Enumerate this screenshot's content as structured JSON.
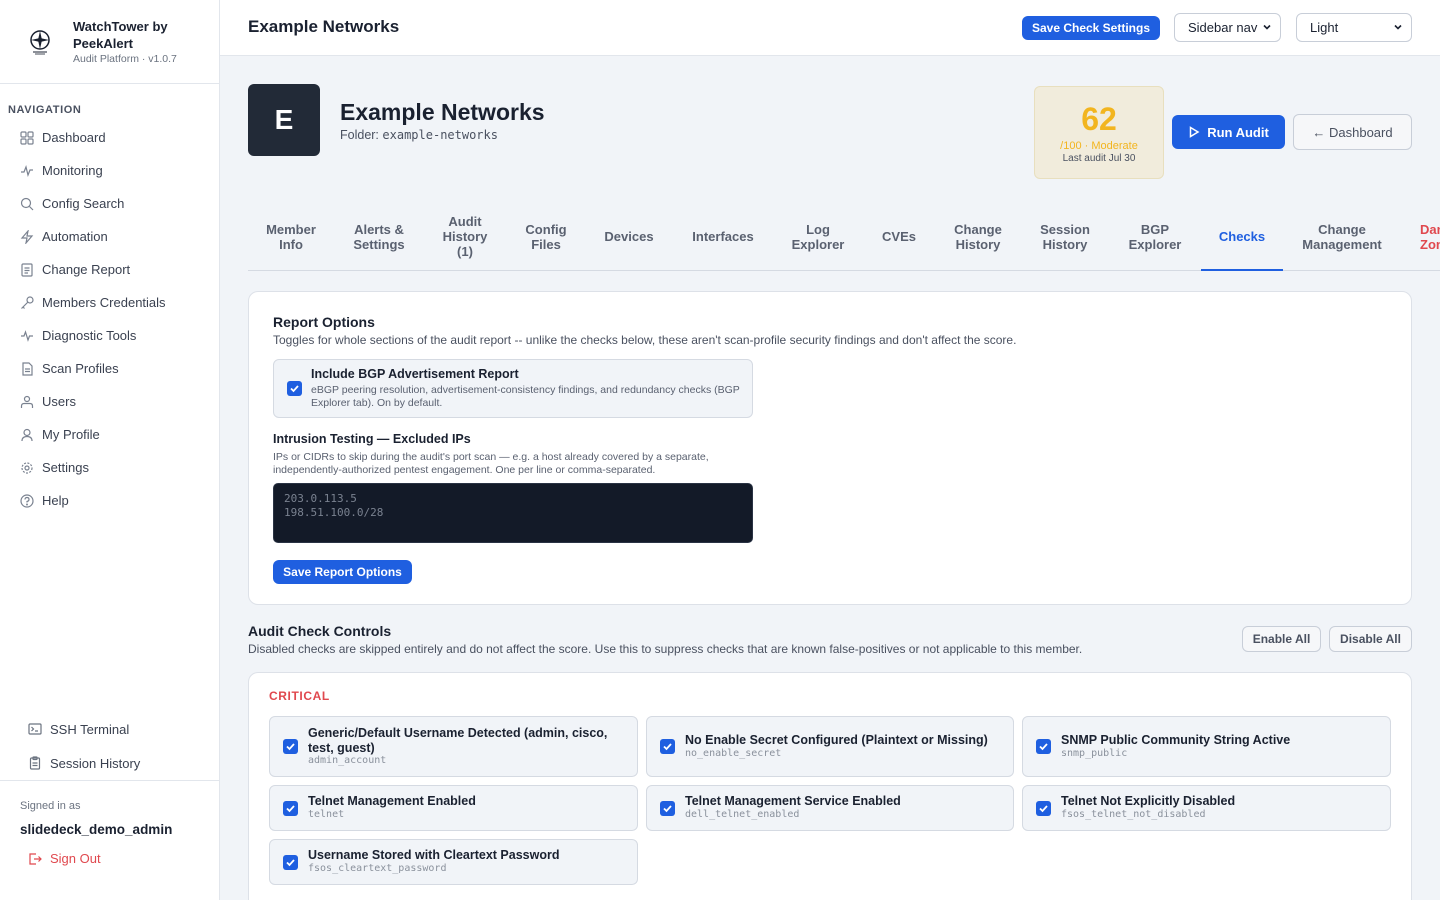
{
  "sidebar": {
    "brand_name": "WatchTower by PeekAlert",
    "brand_sub": "Audit Platform · v1.0.7",
    "nav_heading": "NAVIGATION",
    "items": [
      {
        "label": "Dashboard",
        "icon": "grid-icon"
      },
      {
        "label": "Monitoring",
        "icon": "pulse-icon"
      },
      {
        "label": "Config Search",
        "icon": "search-icon"
      },
      {
        "label": "Automation",
        "icon": "bolt-icon"
      },
      {
        "label": "Change Report",
        "icon": "document-icon"
      },
      {
        "label": "Members Credentials",
        "icon": "key-icon"
      },
      {
        "label": "Diagnostic Tools",
        "icon": "activity-icon"
      },
      {
        "label": "Scan Profiles",
        "icon": "file-icon"
      },
      {
        "label": "Users",
        "icon": "users-icon"
      },
      {
        "label": "My Profile",
        "icon": "user-icon"
      },
      {
        "label": "Settings",
        "icon": "gear-icon"
      },
      {
        "label": "Help",
        "icon": "help-icon"
      }
    ],
    "bottom_links": [
      {
        "label": "SSH Terminal",
        "icon": "terminal-icon"
      },
      {
        "label": "Session History",
        "icon": "clipboard-icon"
      }
    ],
    "signed_in_label": "Signed in as",
    "signed_in_user": "slidedeck_demo_admin",
    "sign_out": "Sign Out"
  },
  "topbar": {
    "title": "Example Networks",
    "save_check_settings": "Save Check Settings",
    "nav_select": "Sidebar nav",
    "theme_select": "Light"
  },
  "header": {
    "avatar_letter": "E",
    "title": "Example Networks",
    "folder_label": "Folder:",
    "folder_value": "example-networks",
    "score": "62",
    "score_sub": "/100 · Moderate",
    "last_audit": "Last audit Jul 30",
    "run_audit": "Run Audit",
    "dashboard": "← Dashboard"
  },
  "tabs": [
    {
      "label": "Member\nInfo"
    },
    {
      "label": "Alerts &\nSettings"
    },
    {
      "label": "Audit\nHistory\n(1)"
    },
    {
      "label": "Config\nFiles"
    },
    {
      "label": "Devices"
    },
    {
      "label": "Interfaces"
    },
    {
      "label": "Log\nExplorer"
    },
    {
      "label": "CVEs"
    },
    {
      "label": "Change\nHistory"
    },
    {
      "label": "Session\nHistory"
    },
    {
      "label": "BGP\nExplorer"
    },
    {
      "label": "Checks"
    },
    {
      "label": "Change\nManagement"
    },
    {
      "label": "Danger\nZone"
    }
  ],
  "report_options": {
    "title": "Report Options",
    "description": "Toggles for whole sections of the audit report -- unlike the checks below, these aren't scan-profile security findings and don't affect the score.",
    "bgp_label": "Include BGP Advertisement Report",
    "bgp_desc": "eBGP peering resolution, advertisement-consistency findings, and redundancy checks (BGP Explorer tab). On by default.",
    "excluded_label": "Intrusion Testing — Excluded IPs",
    "excluded_desc": "IPs or CIDRs to skip during the audit's port scan — e.g. a host already covered by a separate, independently-authorized pentest engagement. One per line or comma-separated.",
    "excluded_value": "203.0.113.5\n198.51.100.0/28",
    "save": "Save Report Options"
  },
  "check_controls": {
    "title": "Audit Check Controls",
    "description": "Disabled checks are skipped entirely and do not affect the score. Use this to suppress checks that are known false-positives or not applicable to this member.",
    "enable_all": "Enable All",
    "disable_all": "Disable All",
    "severity": "CRITICAL",
    "checks": [
      {
        "title": "Generic/Default Username Detected (admin, cisco, test, guest)",
        "id": "admin_account",
        "checked": true
      },
      {
        "title": "No Enable Secret Configured (Plaintext or Missing)",
        "id": "no_enable_secret",
        "checked": true
      },
      {
        "title": "SNMP Public Community String Active",
        "id": "snmp_public",
        "checked": true
      },
      {
        "title": "Telnet Management Enabled",
        "id": "telnet",
        "checked": true
      },
      {
        "title": "Telnet Management Service Enabled",
        "id": "dell_telnet_enabled",
        "checked": true
      },
      {
        "title": "Telnet Not Explicitly Disabled",
        "id": "fsos_telnet_not_disabled",
        "checked": true
      },
      {
        "title": "Username Stored with Cleartext Password",
        "id": "fsos_cleartext_password",
        "checked": true
      }
    ]
  },
  "colors": {
    "accent": "#1f5fe0",
    "score": "#f2b51f",
    "danger": "#e0484e"
  }
}
